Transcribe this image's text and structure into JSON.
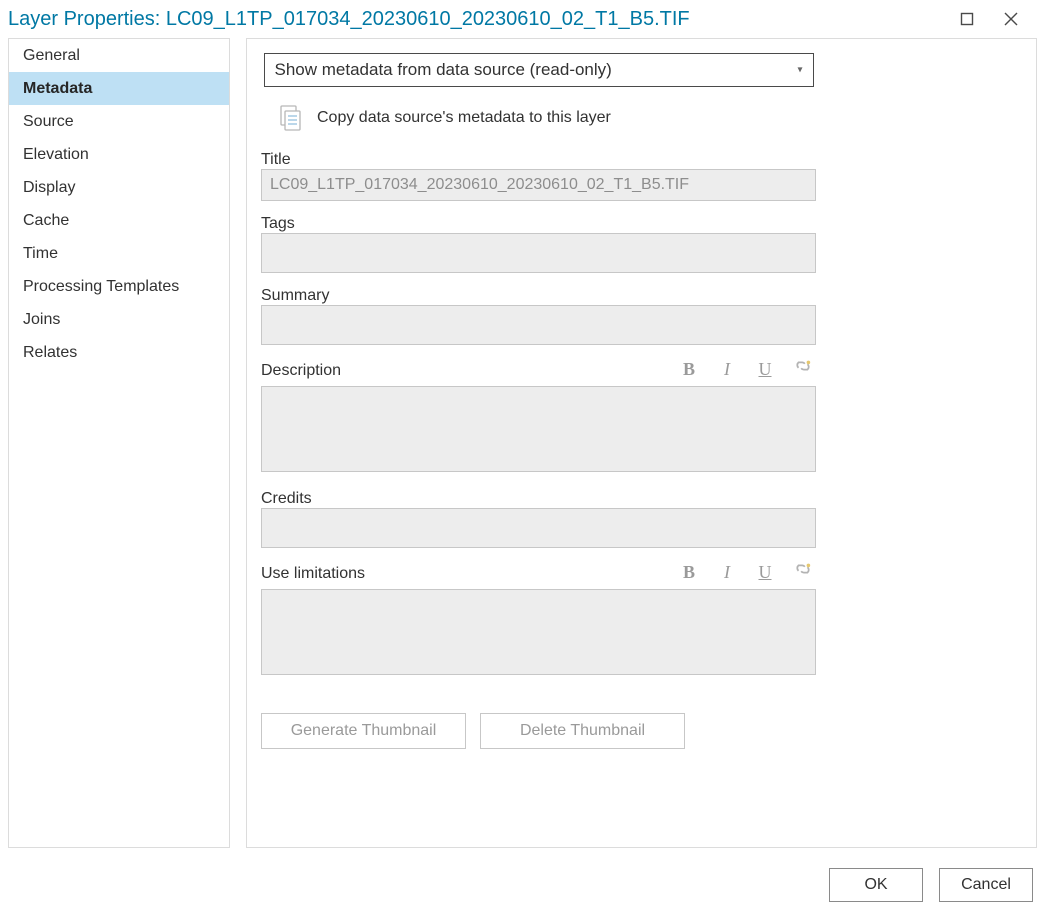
{
  "title_prefix": "Layer Properties: ",
  "layer_name": "LC09_L1TP_017034_20230610_20230610_02_T1_B5.TIF",
  "sidebar": {
    "items": [
      {
        "label": "General"
      },
      {
        "label": "Metadata"
      },
      {
        "label": "Source"
      },
      {
        "label": "Elevation"
      },
      {
        "label": "Display"
      },
      {
        "label": "Cache"
      },
      {
        "label": "Time"
      },
      {
        "label": "Processing Templates"
      },
      {
        "label": "Joins"
      },
      {
        "label": "Relates"
      }
    ],
    "selected_index": 1
  },
  "metadata_panel": {
    "mode_dropdown": "Show metadata from data source (read-only)",
    "copy_label": "Copy data source's metadata to this layer",
    "fields": {
      "title_label": "Title",
      "title_value": "LC09_L1TP_017034_20230610_20230610_02_T1_B5.TIF",
      "tags_label": "Tags",
      "tags_value": "",
      "summary_label": "Summary",
      "summary_value": "",
      "description_label": "Description",
      "description_value": "",
      "credits_label": "Credits",
      "credits_value": "",
      "uselimit_label": "Use limitations",
      "uselimit_value": ""
    },
    "buttons": {
      "generate_thumbnail": "Generate Thumbnail",
      "delete_thumbnail": "Delete Thumbnail"
    }
  },
  "footer": {
    "ok": "OK",
    "cancel": "Cancel"
  }
}
